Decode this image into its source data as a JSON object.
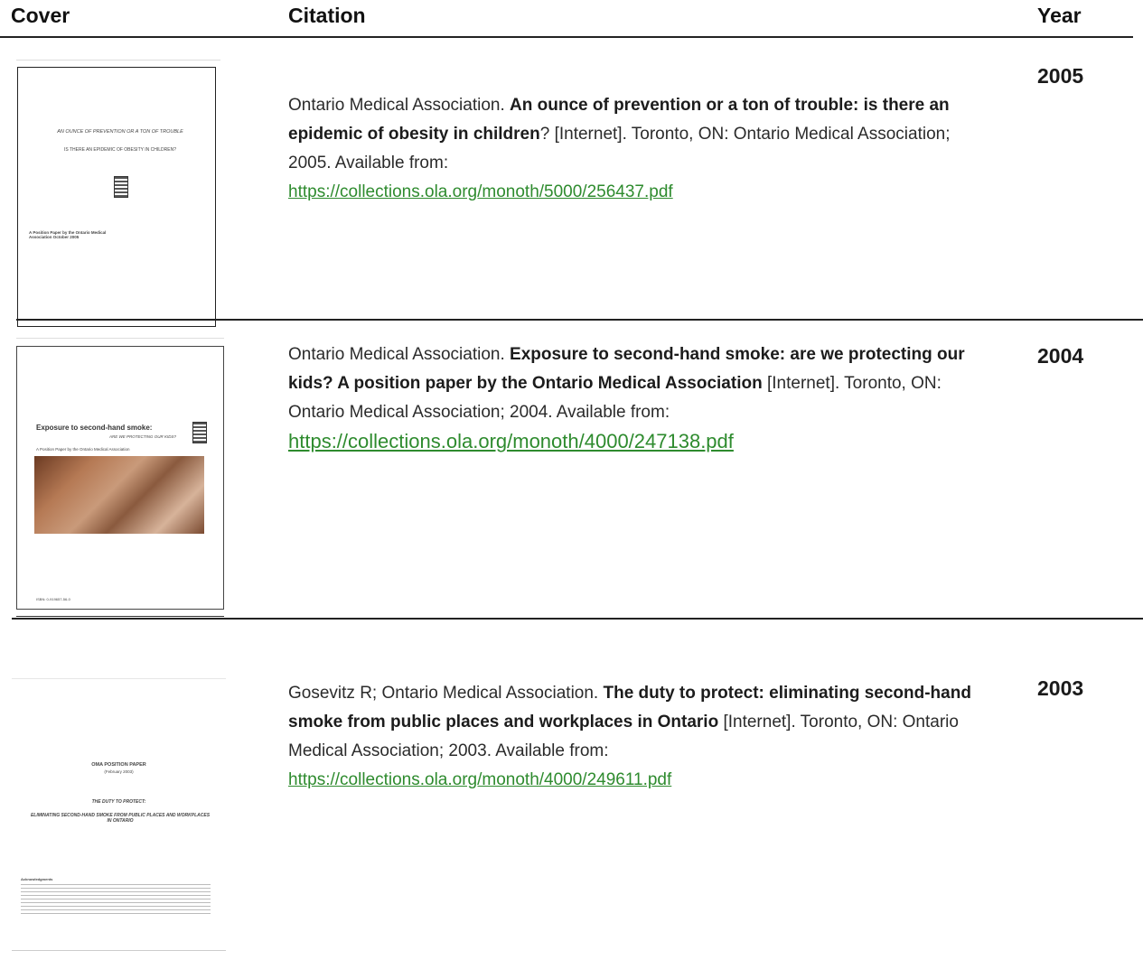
{
  "header": {
    "cover": "Cover",
    "citation": "Citation",
    "year": "Year"
  },
  "rows": [
    {
      "author": "Ontario Medical Association. ",
      "title": "An ounce of prevention or a ton of trouble: is there an epidemic of obesity in children",
      "rest": "? [Internet]. Toronto, ON: Ontario Medical Association; 2005. Available from:",
      "url": "https://collections.ola.org/monoth/5000/256437.pdf",
      "year": "2005",
      "cover": {
        "line1": "AN OUNCE OF PREVENTION OR A TON OF TROUBLE",
        "line2": "IS THERE AN EPIDEMIC OF OBESITY IN CHILDREN?",
        "foot": "A Position Paper by the Ontario Medical Association October 2005"
      }
    },
    {
      "author": "Ontario Medical Association. ",
      "title": "Exposure to second-hand smoke: are we protecting our kids? A position paper by the Ontario Medical Association",
      "rest": " [Internet]. Toronto, ON: Ontario Medical Association; 2004. Available from:",
      "url": "https://collections.ola.org/monoth/4000/247138.pdf",
      "year": "2004",
      "cover": {
        "line1": "Exposure to second-hand smoke:",
        "line2": "ARE WE PROTECTING OUR KIDS?",
        "line3": "A Position Paper by the Ontario Medical Association",
        "foot": "ISBN: 0-919657-56-0"
      }
    },
    {
      "author": "Gosevitz R; Ontario Medical Association. ",
      "title": "The duty to protect: eliminating second-hand smoke from public places and workplaces in Ontario",
      "rest": " [Internet]. Toronto, ON: Ontario Medical Association; 2003. Available from:",
      "url": "https://collections.ola.org/monoth/4000/249611.pdf",
      "year": "2003",
      "cover": {
        "line1": "OMA POSITION PAPER",
        "line2": "(February 2003)",
        "line3": "THE DUTY TO PROTECT:",
        "line4": "ELIMINATING SECOND-HAND SMOKE FROM PUBLIC PLACES AND WORKPLACES IN ONTARIO",
        "foot": "Acknowledgments"
      }
    }
  ]
}
